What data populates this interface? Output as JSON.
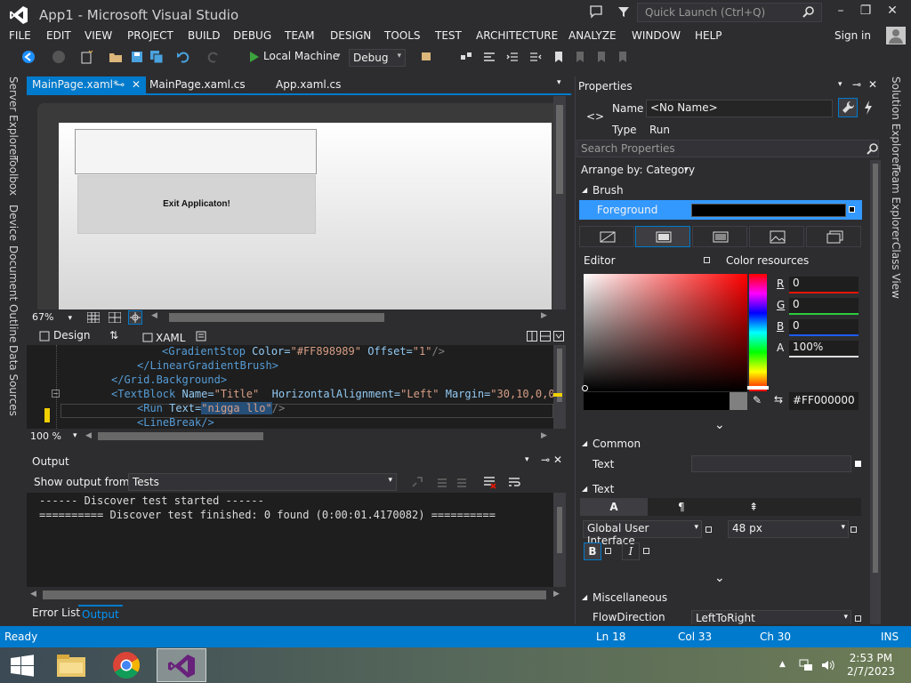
{
  "window": {
    "title": "App1 - Microsoft Visual Studio",
    "quick_launch_placeholder": "Quick Launch (Ctrl+Q)",
    "sign_in": "Sign in"
  },
  "menu": [
    "FILE",
    "EDIT",
    "VIEW",
    "PROJECT",
    "BUILD",
    "DEBUG",
    "TEAM",
    "DESIGN",
    "TOOLS",
    "TEST",
    "ARCHITECTURE",
    "ANALYZE",
    "WINDOW",
    "HELP"
  ],
  "toolbar": {
    "run_target": "Local Machine",
    "configuration": "Debug"
  },
  "left_tabs": [
    "Server Explorer",
    "Toolbox",
    "Device",
    "Document Outline",
    "Data Sources"
  ],
  "right_tabs": [
    "Solution Explorer",
    "Team Explorer",
    "Class View"
  ],
  "doc_tabs": [
    {
      "label": "MainPage.xaml*",
      "pin": "⊸",
      "close": "✕"
    },
    {
      "label": "MainPage.xaml.cs"
    },
    {
      "label": "App.xaml.cs"
    }
  ],
  "designer": {
    "button_text": "Exit Applicaton!",
    "zoom": "67%"
  },
  "split": {
    "design_tab": "Design",
    "xaml_tab": "XAML"
  },
  "code": {
    "line1_tag": "<GradientStop",
    "line1_attr1": " Color=",
    "line1_val1": "\"#FF898989\"",
    "line1_attr2": " Offset=",
    "line1_val2": "\"1\"",
    "line1_end": "/>",
    "line2": "</LinearGradientBrush>",
    "line3": "</Grid.Background>",
    "line4_tag": "<TextBlock",
    "line4_attr1": " Name=",
    "line4_val1": "\"Title\"",
    "line4_attr2": "  HorizontalAlignment=",
    "line4_val2": "\"Left\"",
    "line4_attr3": " Margin=",
    "line4_val3": "\"30,10,0,0\"",
    "line5_tag": "<Run",
    "line5_attr": " Text=",
    "line5_val": "\"nigga llo\"",
    "line5_end": "/>",
    "line6": "<LineBreak/>",
    "zoom": "100 %"
  },
  "output": {
    "title": "Output",
    "show_from_label": "Show output from:",
    "source": "Tests",
    "lines": [
      "------ Discover test started ------",
      "========== Discover test finished: 0 found (0:00:01.4170082) =========="
    ],
    "bottom_tabs": [
      "Error List",
      "Output"
    ]
  },
  "properties": {
    "title": "Properties",
    "name_label": "Name",
    "name_value": "<No Name>",
    "type_label": "Type",
    "type_value": "Run",
    "search_placeholder": "Search Properties",
    "arrange_by": "Arrange by: Category",
    "brush_section": "Brush",
    "foreground_label": "Foreground",
    "editor_label": "Editor",
    "color_resources_label": "Color resources",
    "r_label": "R",
    "r_value": "0",
    "g_label": "G",
    "g_value": "0",
    "b_label": "B",
    "b_value": "0",
    "a_label": "A",
    "a_value": "100%",
    "hex_value": "#FF000000",
    "common_section": "Common",
    "text_label": "Text",
    "text_section": "Text",
    "font_family": "Global User Interface",
    "font_size": "48 px",
    "bold_label": "B",
    "italic_label": "I",
    "misc_section": "Miscellaneous",
    "flow_label": "FlowDirection",
    "flow_value": "LeftToRight"
  },
  "status": {
    "state": "Ready",
    "line": "Ln 18",
    "col": "Col 33",
    "ch": "Ch 30",
    "mode": "INS"
  },
  "taskbar": {
    "time": "2:53 PM",
    "date": "2/7/2023"
  },
  "colors": {
    "accent": "#007acc",
    "background": "#2d2d30",
    "editor_bg": "#1e1e1e",
    "selection": "#3399ff"
  }
}
